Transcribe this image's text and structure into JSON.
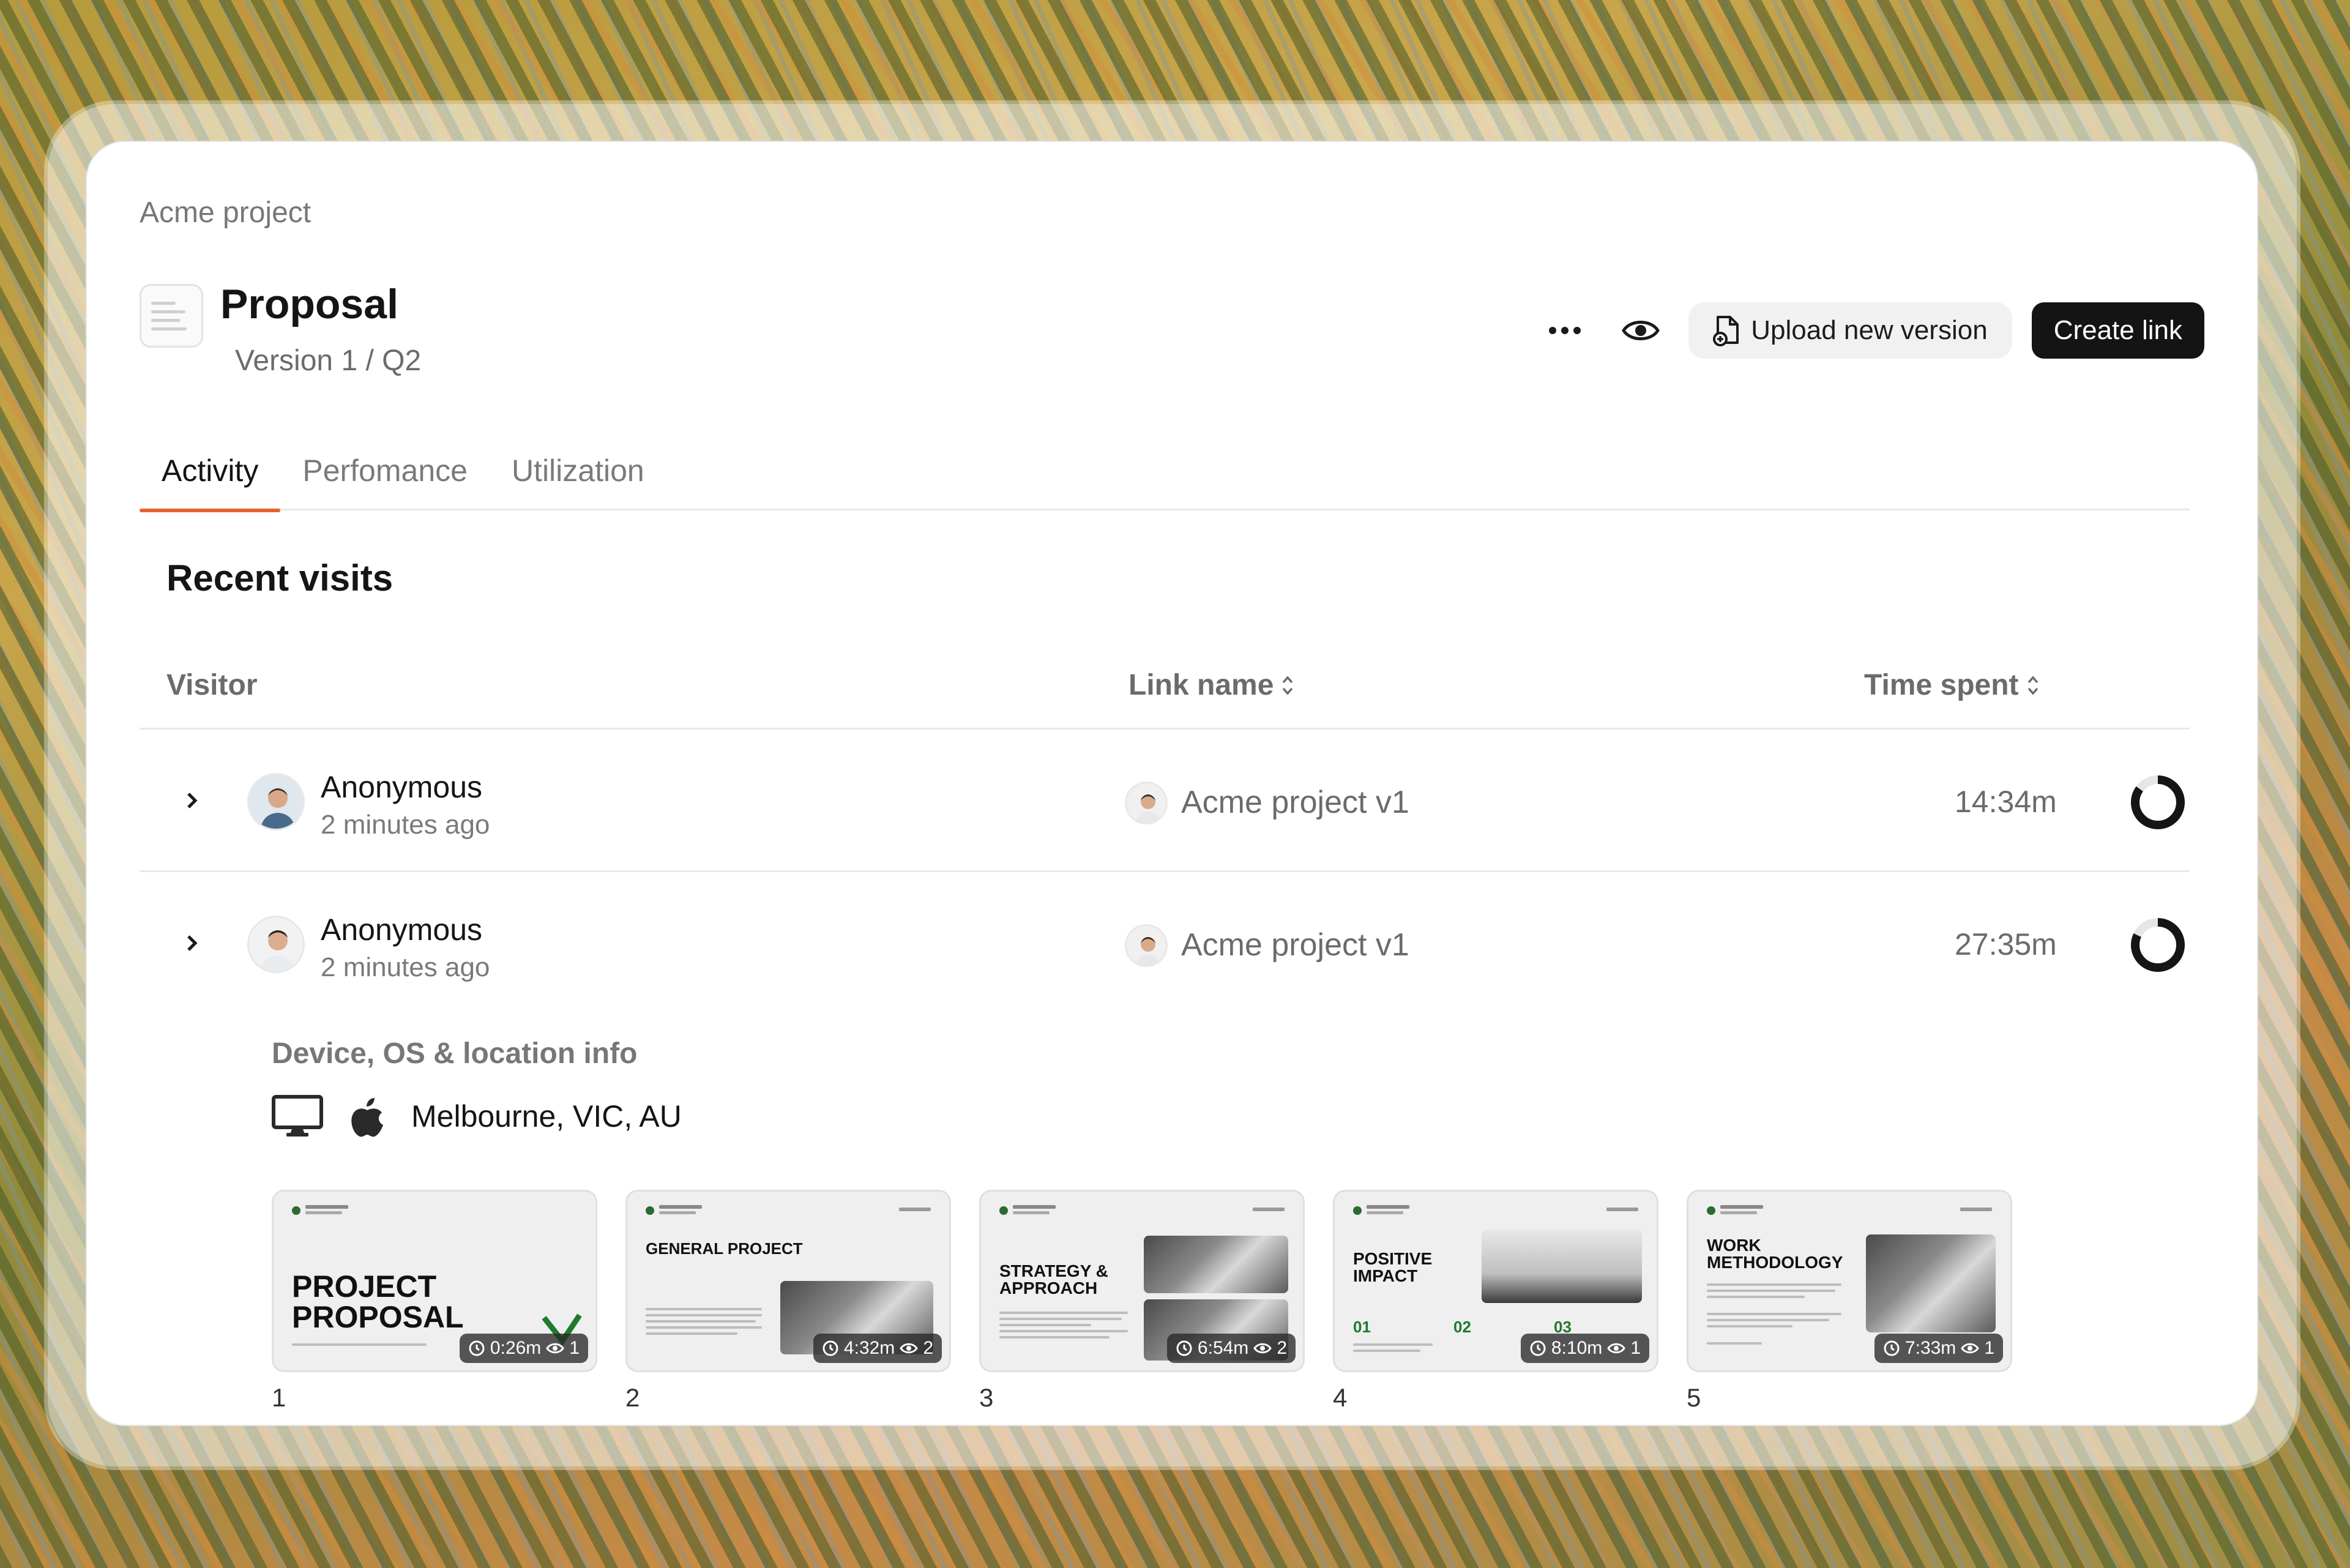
{
  "breadcrumb": "Acme project",
  "document": {
    "title": "Proposal",
    "version": "Version 1 / Q2"
  },
  "toolbar": {
    "more_icon": "more-horizontal-icon",
    "preview_icon": "eye-icon",
    "upload_label": "Upload new version",
    "create_label": "Create link"
  },
  "tabs": [
    {
      "label": "Activity",
      "active": true
    },
    {
      "label": "Perfomance",
      "active": false
    },
    {
      "label": "Utilization",
      "active": false
    }
  ],
  "recent_visits": {
    "title": "Recent visits",
    "columns": {
      "visitor": "Visitor",
      "link_name": "Link name",
      "time_spent": "Time spent"
    },
    "rows": [
      {
        "visitor": "Anonymous",
        "when": "2 minutes ago",
        "link": "Acme project v1",
        "time": "14:34m",
        "progress": 0.85,
        "expanded": false
      },
      {
        "visitor": "Anonymous",
        "when": "2 minutes ago",
        "link": "Acme project v1",
        "time": "27:35m",
        "progress": 0.82,
        "expanded": true
      }
    ]
  },
  "device_info": {
    "title": "Device, OS & location info",
    "device_icon": "desktop-icon",
    "os_icon": "apple-icon",
    "location": "Melbourne, VIC, AU"
  },
  "slides": [
    {
      "number": "1",
      "heading": "PROJECT PROPOSAL",
      "time": "0:26m",
      "views": "1"
    },
    {
      "number": "2",
      "heading": "GENERAL PROJECT",
      "time": "4:32m",
      "views": "2"
    },
    {
      "number": "3",
      "heading": "STRATEGY & APPROACH",
      "time": "6:54m",
      "views": "2"
    },
    {
      "number": "4",
      "heading": "POSITIVE IMPACT",
      "time": "8:10m",
      "views": "1"
    },
    {
      "number": "5",
      "heading": "WORK METHODOLOGY",
      "time": "7:33m",
      "views": "1"
    }
  ],
  "colors": {
    "accent": "#e2622f",
    "primary_button": "#141414"
  }
}
